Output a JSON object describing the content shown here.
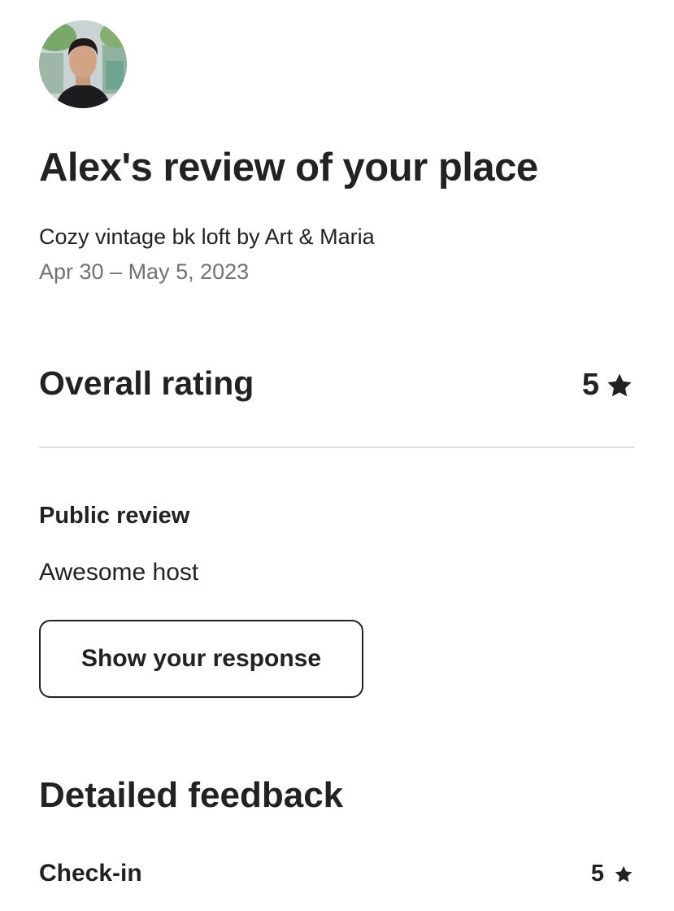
{
  "reviewer": {
    "avatar_icon": "user-avatar-photo"
  },
  "header": {
    "title": "Alex's review of your place",
    "listing_name": "Cozy vintage bk loft by Art & Maria",
    "stay_dates": "Apr 30 – May 5, 2023"
  },
  "overall_rating": {
    "label": "Overall rating",
    "value": "5",
    "icon": "star-icon"
  },
  "public_review": {
    "label": "Public review",
    "text": "Awesome host",
    "button_label": "Show your response"
  },
  "detailed_feedback": {
    "title": "Detailed feedback",
    "items": [
      {
        "label": "Check-in",
        "value": "5",
        "icon": "star-icon"
      }
    ]
  },
  "colors": {
    "text_primary": "#222222",
    "text_secondary": "#717171",
    "divider": "#dddddd",
    "background": "#ffffff"
  }
}
